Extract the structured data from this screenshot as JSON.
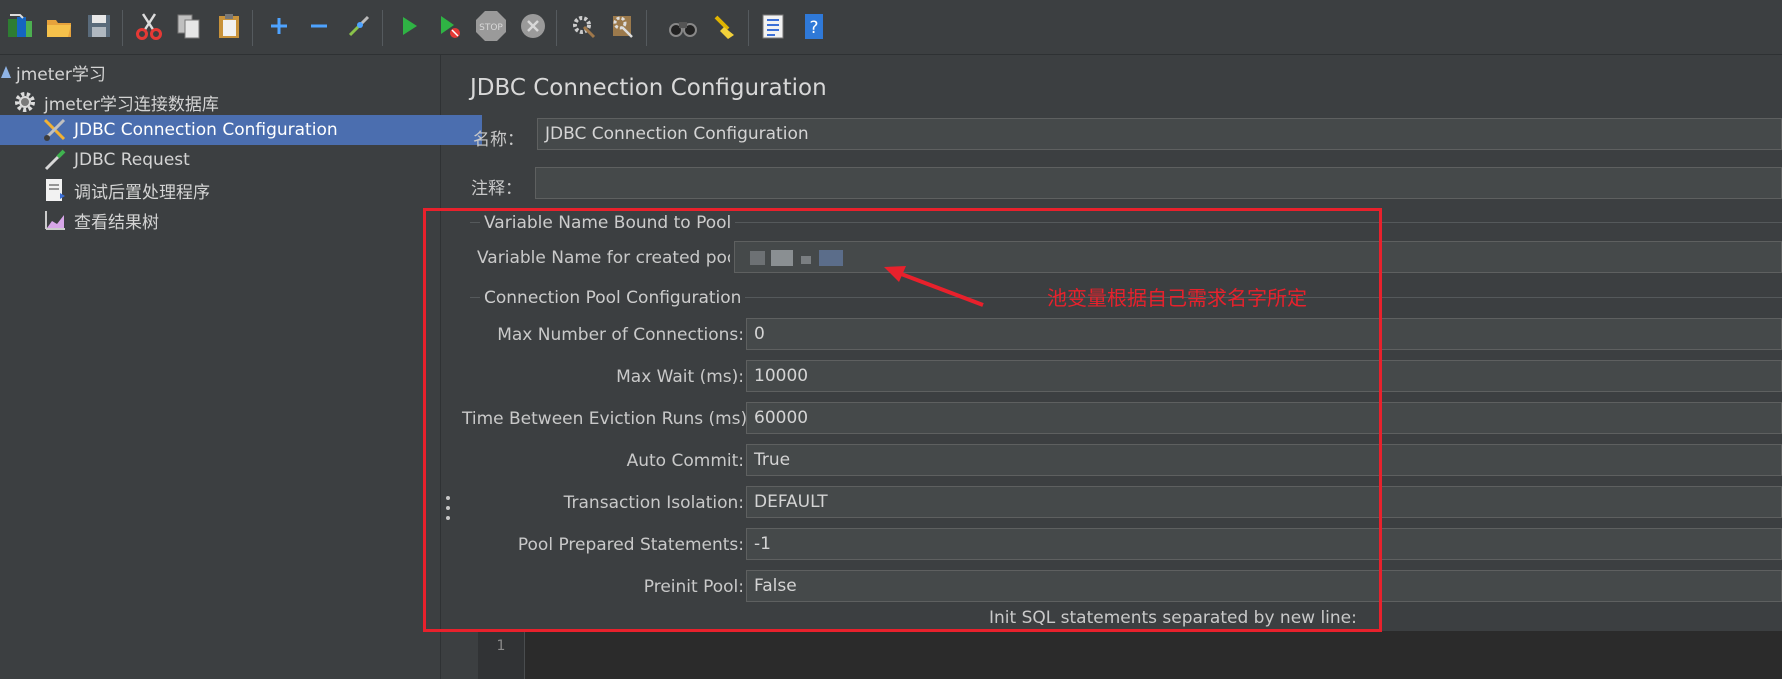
{
  "toolbar": {
    "icons": [
      "new-template-icon",
      "open-folder-icon",
      "save-icon",
      "cut-icon",
      "copy-icon",
      "paste-icon",
      "expand-icon",
      "collapse-icon",
      "toggle-icon",
      "start-icon",
      "start-no-pause-icon",
      "stop-icon",
      "shutdown-icon",
      "clear-icon",
      "clear-all-icon",
      "search-icon",
      "reset-search-icon",
      "function-helper-icon",
      "help-icon"
    ]
  },
  "tree": {
    "nodes": [
      {
        "label": "jmeter学习",
        "icon": "test-plan-icon"
      },
      {
        "label": "jmeter学习连接数据库",
        "icon": "thread-group-gear-icon"
      },
      {
        "label": "JDBC Connection Configuration",
        "icon": "config-element-icon"
      },
      {
        "label": "JDBC Request",
        "icon": "sampler-pipette-icon"
      },
      {
        "label": "调试后置处理程序",
        "icon": "post-processor-icon"
      },
      {
        "label": "查看结果树",
        "icon": "listener-chart-icon"
      }
    ]
  },
  "panel": {
    "title": "JDBC Connection Configuration",
    "name_label": "名称：",
    "name_value": "JDBC Connection Configuration",
    "comment_label": "注释：",
    "comment_value": "",
    "bound_section": "Variable Name Bound to Pool",
    "pool_var_label": "Variable Name for created pool",
    "pool_section": "Connection Pool Configuration",
    "fields": [
      {
        "label": "Max Number of Connections:",
        "value": "0"
      },
      {
        "label": "Max Wait (ms):",
        "value": "10000"
      },
      {
        "label": "Time Between Eviction Runs (ms):",
        "value": "60000"
      },
      {
        "label": "Auto Commit:",
        "value": "True"
      },
      {
        "label": "Transaction Isolation:",
        "value": "DEFAULT"
      },
      {
        "label": "Pool Prepared Statements:",
        "value": "-1"
      },
      {
        "label": "Preinit Pool:",
        "value": "False"
      }
    ],
    "init_sql_label": "Init SQL statements separated by new line:",
    "editor_line_number": "1"
  },
  "annotation": {
    "note": "池变量根据自己需求名字所定",
    "color": "#e8212c"
  },
  "colors": {
    "background": "#3c3f41",
    "selection": "#4b6eaf",
    "field": "#45494a"
  }
}
